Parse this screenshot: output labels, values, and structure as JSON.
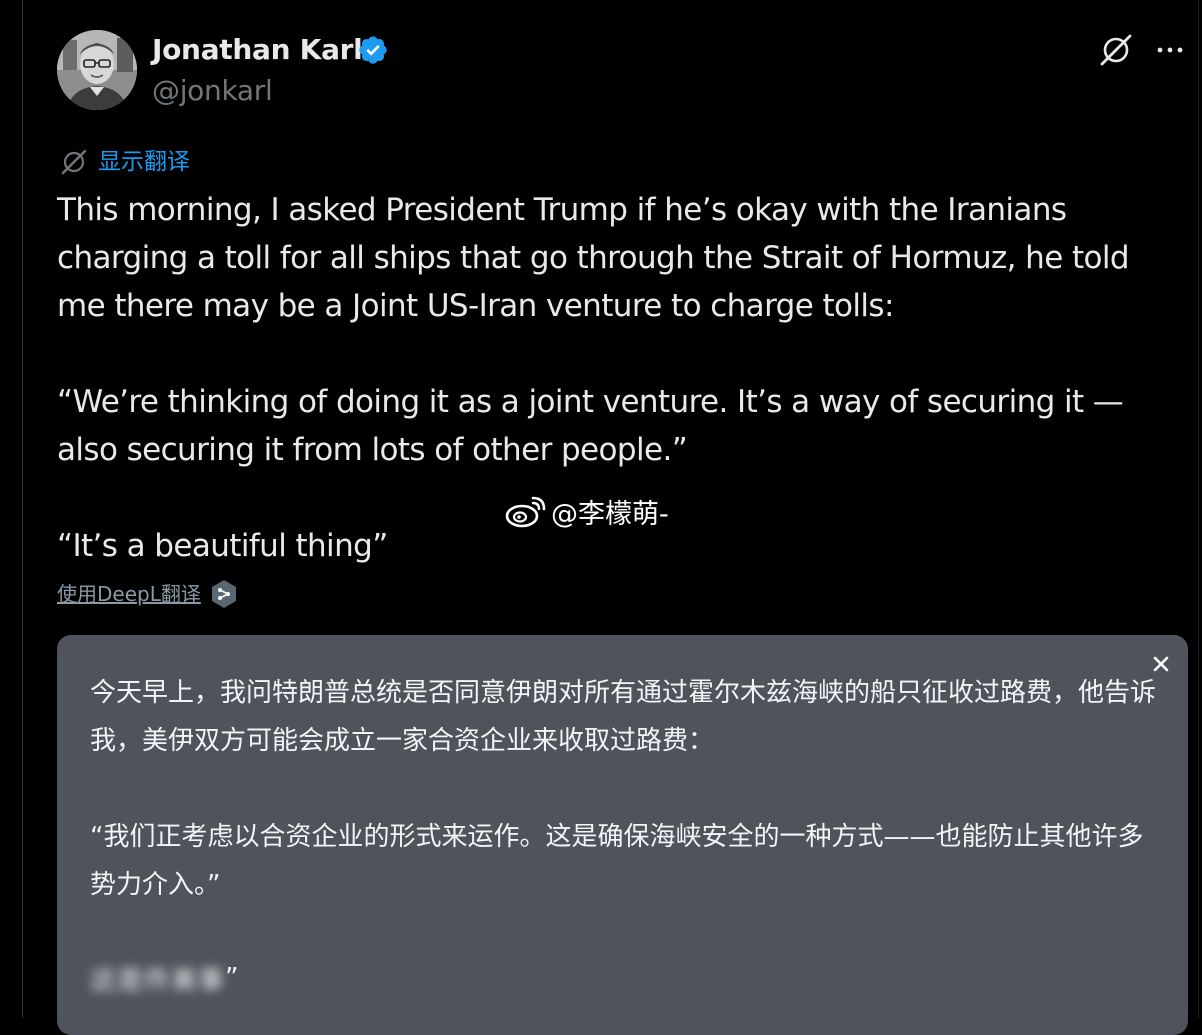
{
  "author": {
    "name": "Jonathan Karl",
    "handle": "@jonkarl"
  },
  "actions": {
    "show_translation": "显示翻译",
    "translate_with_deepl": "使用DeepL翻译"
  },
  "tweet": {
    "paragraphs": [
      "This morning, I asked President Trump if he’s okay with the Iranians\ncharging a toll for all ships that go through the Strait of Hormuz, he told\nme there may be a Joint US-Iran venture to charge tolls:",
      "“We’re thinking of doing it as a joint venture. It’s a way of securing it —\nalso securing it from lots of other people.”",
      "“It’s a beautiful thing”"
    ]
  },
  "watermark": {
    "text": "@李檬萌-"
  },
  "translation": {
    "paragraphs": [
      "今天早上，我问特朗普总统是否同意伊朗对所有通过霍尔木兹海峡的船只征收过路费，他告诉我，美伊双方可能会成立一家合资企业来收取过路费：",
      "“我们正考虑以合资企业的形式来运作。这是确保海峡安全的一种方式——也能防止其他许多势力介入。”"
    ],
    "blurred_text": "这是件美事",
    "closing_quote": "”"
  },
  "colors": {
    "background": "#000000",
    "text": "#e7e9ea",
    "secondary": "#71767b",
    "link": "#1d9bf0",
    "verified": "#1d9bf0",
    "panel": "#4f545c"
  },
  "icons": [
    "verified-badge-icon",
    "grok-icon",
    "more-icon",
    "translate-icon",
    "deepl-icon",
    "weibo-icon",
    "close-icon"
  ]
}
